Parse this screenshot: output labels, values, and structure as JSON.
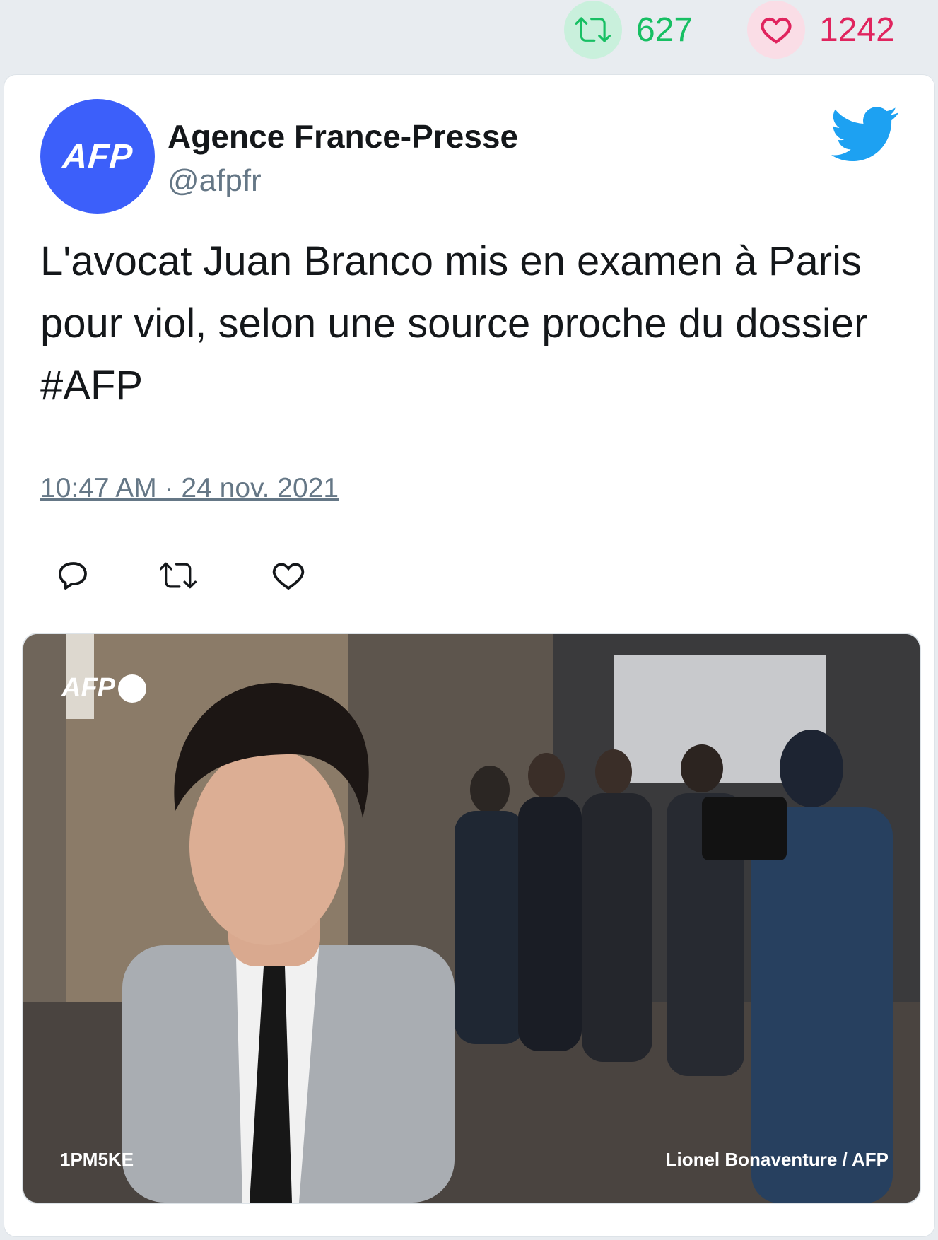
{
  "stats": {
    "retweets": "627",
    "likes": "1242",
    "retweet_color": "#17bf63",
    "like_color": "#e0245e"
  },
  "tweet": {
    "author_name": "Agence France-Presse",
    "handle": "@afpfr",
    "avatar_text": "AFP",
    "avatar_color": "#3c5ffa",
    "text": "L'avocat Juan Branco mis en examen à Paris pour viol, selon une source proche du dossier #AFP",
    "timestamp": "10:47 AM · 24 nov. 2021",
    "brand_icon": "twitter-bird-icon",
    "brand_color": "#1da1f2"
  },
  "actions": {
    "reply_icon": "reply-icon",
    "retweet_icon": "retweet-icon",
    "like_icon": "heart-icon"
  },
  "media": {
    "watermark": "AFP",
    "photo_code": "1PM5KE",
    "credit": "Lionel Bonaventure / AFP"
  }
}
